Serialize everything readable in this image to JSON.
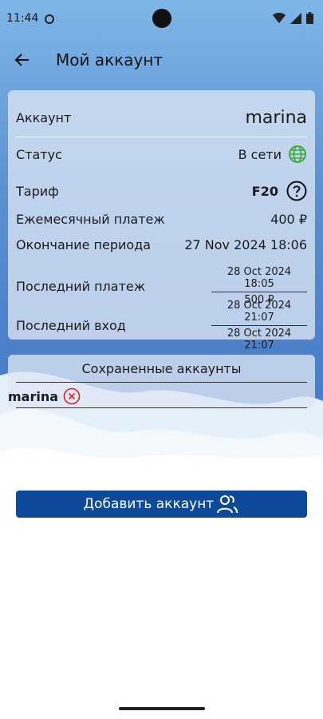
{
  "status_bar": {
    "time": "11:44"
  },
  "appbar": {
    "title": "Мой аккаунт"
  },
  "account": {
    "account_label": "Аккаунт",
    "username": "marina",
    "status_label": "Статус",
    "status_value": "В сети",
    "tariff_label": "Тариф",
    "tariff_value": "F20",
    "monthly_label": "Ежемесячный платеж",
    "monthly_value": "400 ₽",
    "period_end_label": "Окончание периода",
    "period_end_value": "27 Nov 2024 18:06",
    "last_payment_label": "Последний платеж",
    "last_payment_date": "28 Oct 2024 18:05",
    "last_payment_amount": "500 ₽",
    "last_login_label": "Последний вход",
    "last_login_1": "28 Oct 2024 21:07",
    "last_login_2": "28 Oct 2024 21:07"
  },
  "saved": {
    "title": "Сохраненные аккаунты",
    "items": [
      {
        "name": "marina"
      }
    ]
  },
  "add_button": {
    "label": "Добавить аккаунт"
  },
  "colors": {
    "accent": "#0d4a99",
    "online": "#3caa3c",
    "remove": "#d22"
  },
  "icons": [
    "back-arrow-icon",
    "globe-icon",
    "help-icon",
    "remove-icon",
    "users-icon"
  ]
}
